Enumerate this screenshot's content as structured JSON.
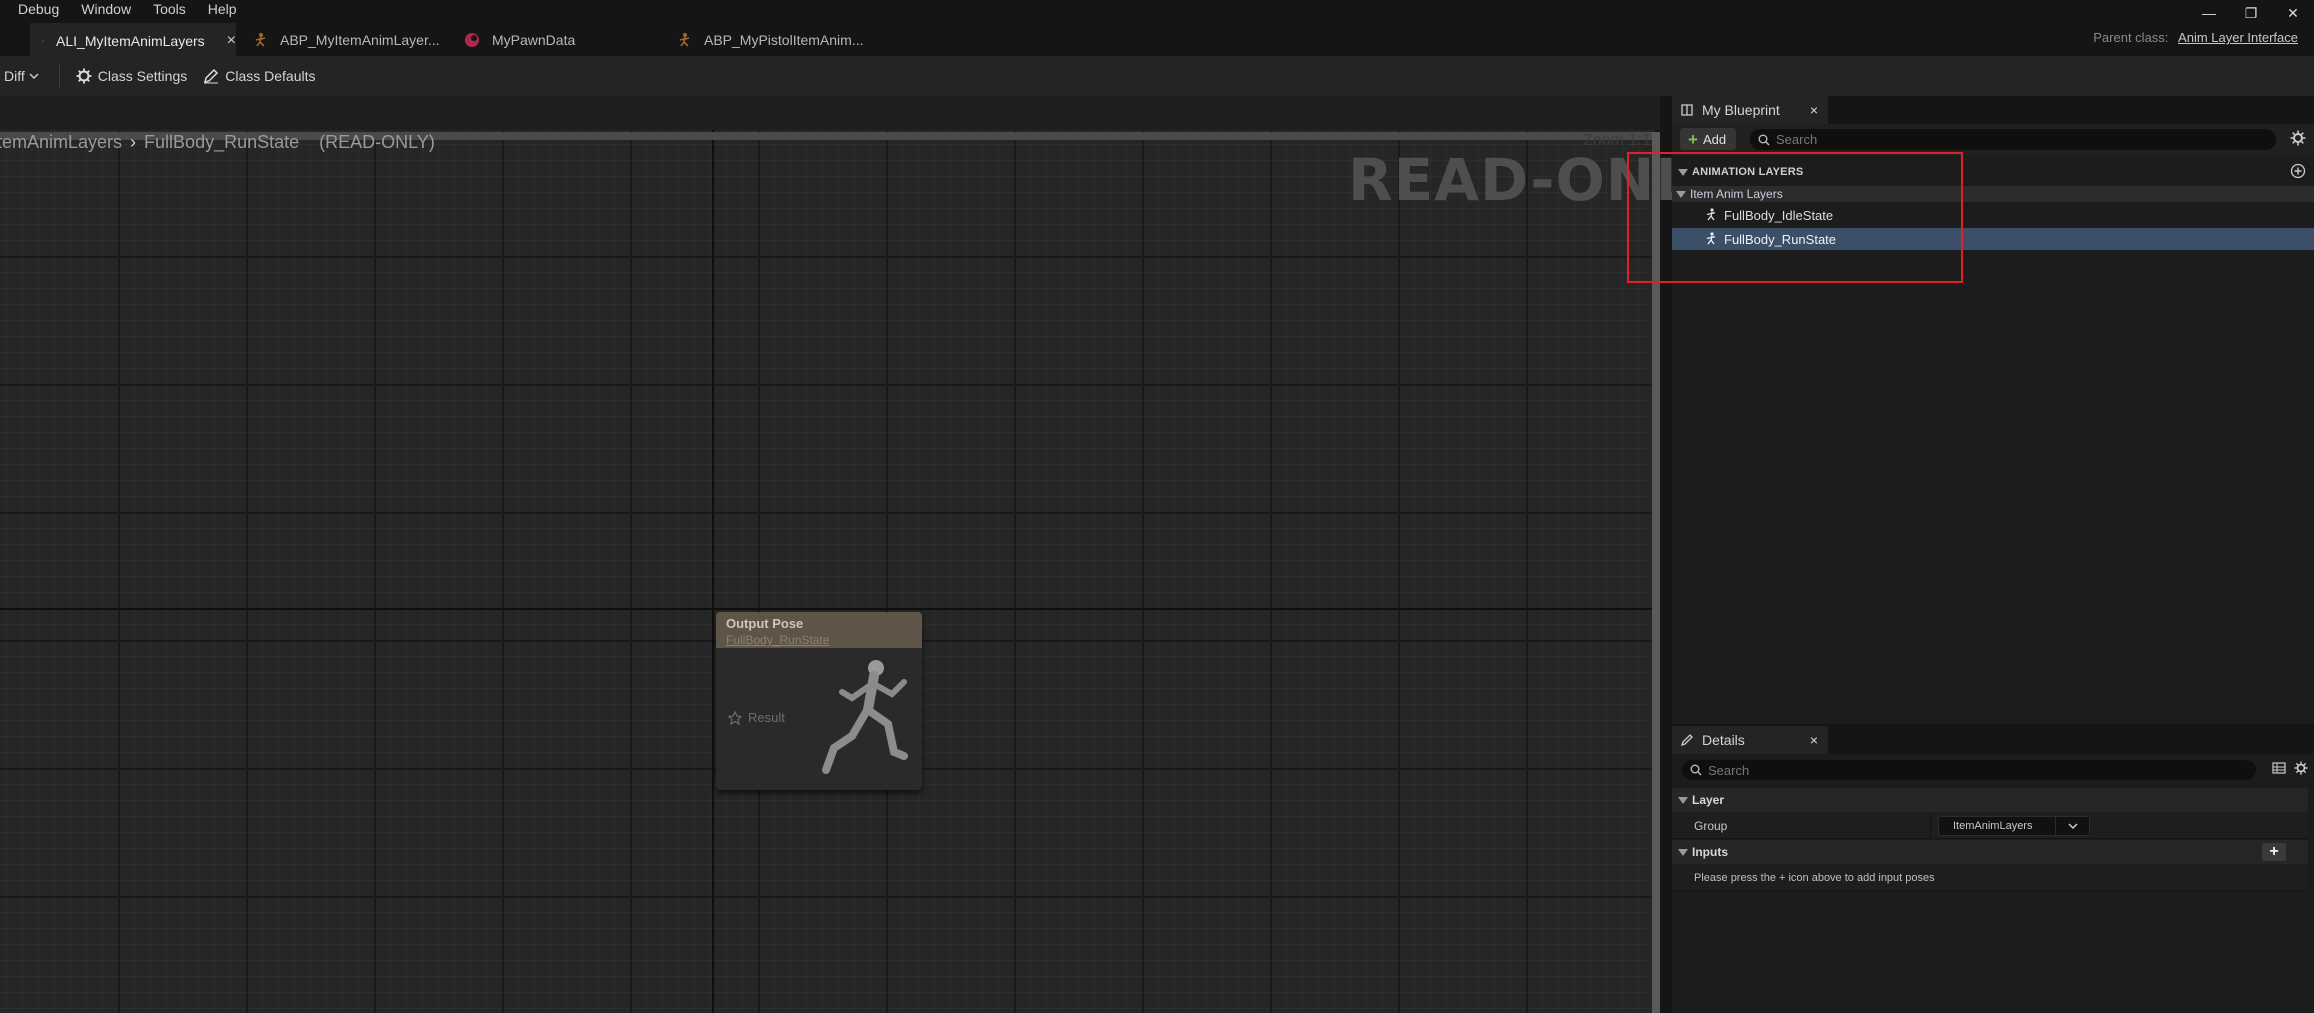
{
  "menu": [
    "Debug",
    "Window",
    "Tools",
    "Help"
  ],
  "window_controls": {
    "minimize": "—",
    "restore": "❐",
    "close": "✕"
  },
  "tabs": [
    {
      "label": "ALI_MyItemAnimLayers",
      "active": true,
      "close": "×",
      "icon": "anim-layer-interface-icon"
    },
    {
      "label": "ABP_MyItemAnimLayer...",
      "active": false,
      "icon": "anim-blueprint-icon"
    },
    {
      "label": "MyPawnData",
      "active": false,
      "icon": "data-asset-icon"
    },
    {
      "label": "ABP_MyPistolItemAnim...",
      "active": false,
      "icon": "anim-blueprint-icon"
    }
  ],
  "parent_class": {
    "label": "Parent class:",
    "value": "Anim Layer Interface"
  },
  "toolbar": {
    "diff": "Diff",
    "class_settings": "Class Settings",
    "class_defaults": "Class Defaults"
  },
  "graph": {
    "breadcrumb_root": "ItemAnimLayers",
    "breadcrumb_leaf": "FullBody_RunState",
    "readonly_tag": "(READ-ONLY)",
    "zoom": "Zoom 1:1",
    "watermark": "READ-ONLY",
    "node": {
      "title": "Output Pose",
      "subtitle": "FullBody_RunState",
      "pin": "Result"
    }
  },
  "my_blueprint": {
    "tab_label": "My Blueprint",
    "close": "×",
    "add_label": "Add",
    "search_placeholder": "Search",
    "section": "ANIMATION LAYERS",
    "category": "Item Anim Layers",
    "items": [
      {
        "label": "FullBody_IdleState",
        "selected": false
      },
      {
        "label": "FullBody_RunState",
        "selected": true
      }
    ]
  },
  "details": {
    "tab_label": "Details",
    "close": "×",
    "search_placeholder": "Search",
    "layer_category": "Layer",
    "group_label": "Group",
    "group_value": "ItemAnimLayers",
    "inputs_category": "Inputs",
    "inputs_hint": "Please press the + icon above to add input poses"
  },
  "colors": {
    "accent_selection": "#3b5068",
    "highlight_box": "#e0202a",
    "add_plus": "#7dc242"
  }
}
